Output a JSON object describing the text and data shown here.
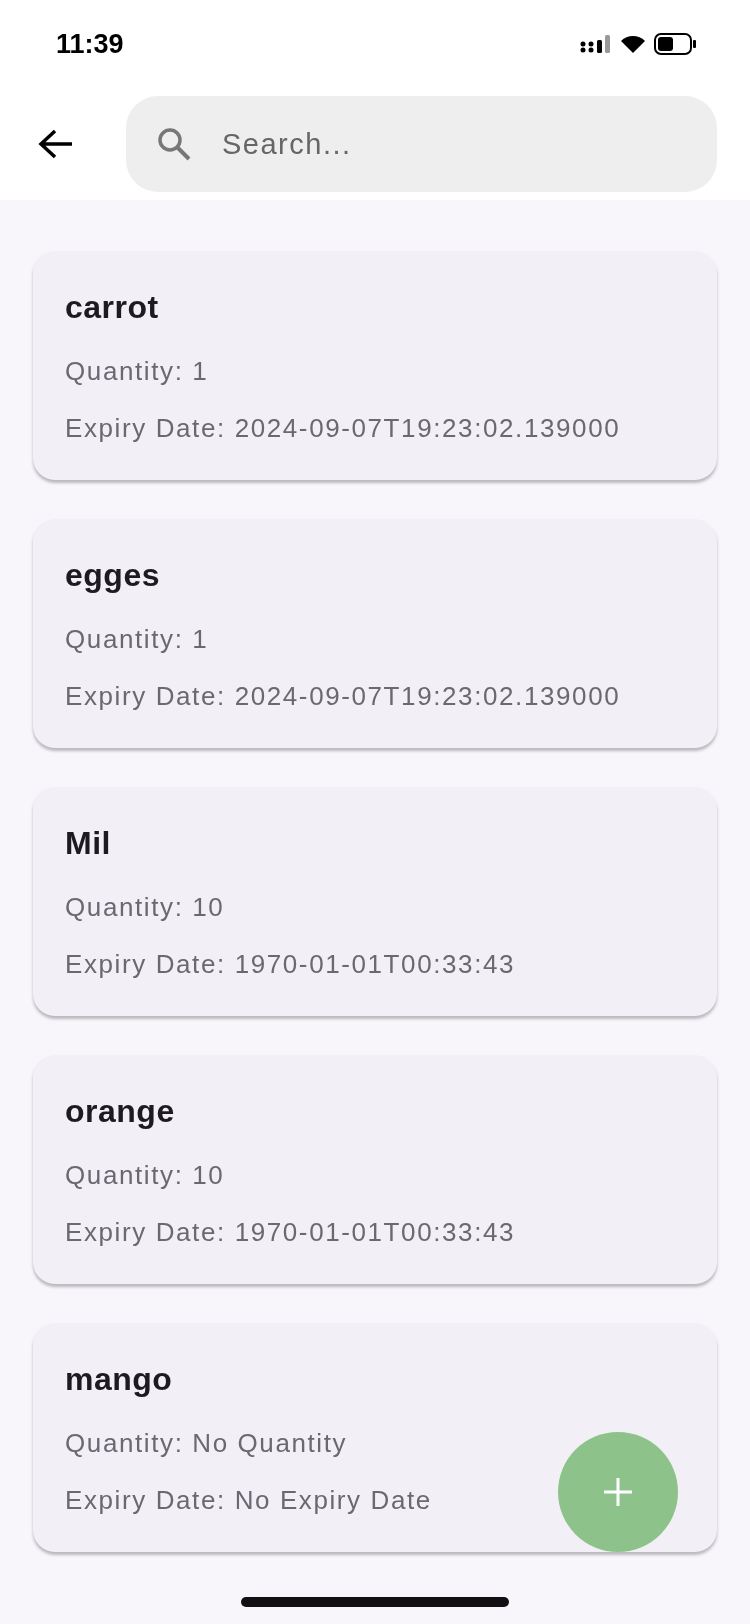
{
  "status_bar": {
    "time": "11:39"
  },
  "search": {
    "placeholder": "Search..."
  },
  "items": [
    {
      "name": "carrot",
      "quantity": "Quantity: 1",
      "expiry": "Expiry Date: 2024-09-07T19:23:02.139000"
    },
    {
      "name": "egges",
      "quantity": "Quantity: 1",
      "expiry": "Expiry Date: 2024-09-07T19:23:02.139000"
    },
    {
      "name": "Mil",
      "quantity": "Quantity: 10",
      "expiry": "Expiry Date: 1970-01-01T00:33:43"
    },
    {
      "name": "orange",
      "quantity": "Quantity: 10",
      "expiry": "Expiry Date: 1970-01-01T00:33:43"
    },
    {
      "name": "mango",
      "quantity": "Quantity: No Quantity",
      "expiry": "Expiry Date: No Expiry Date"
    }
  ]
}
